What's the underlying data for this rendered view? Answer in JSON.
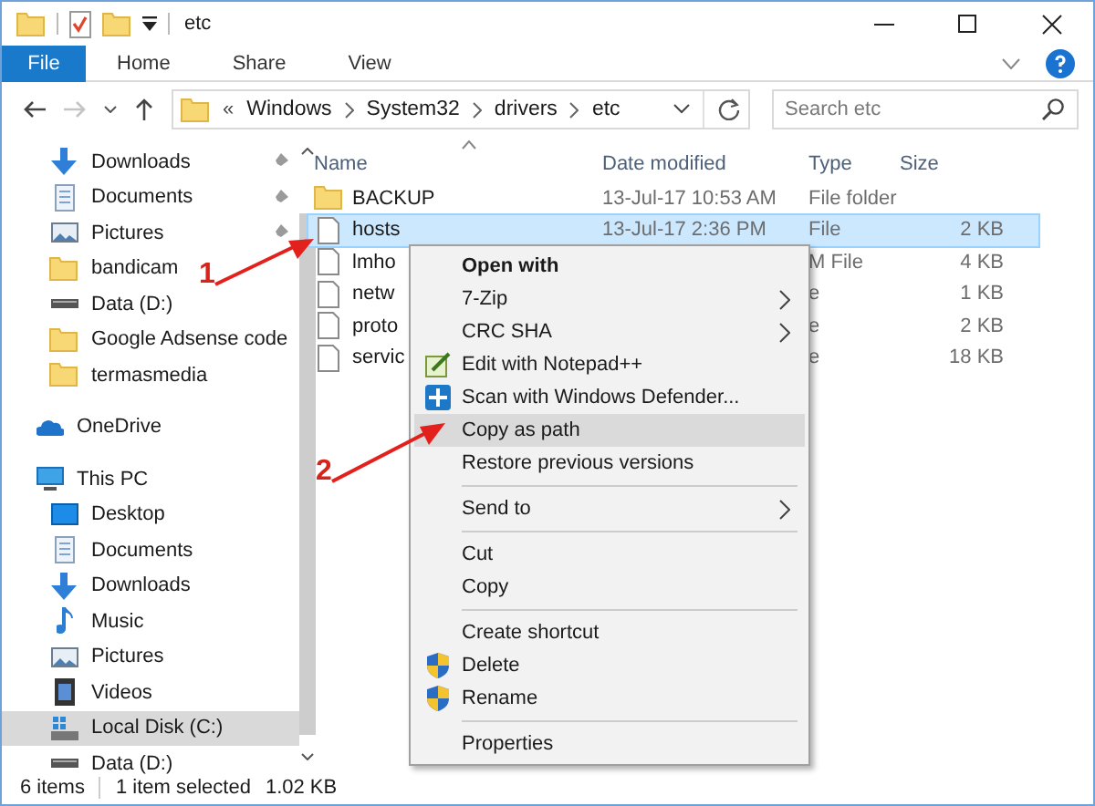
{
  "window": {
    "title": "etc"
  },
  "ribbon": {
    "tabs": [
      {
        "label": "File",
        "selected": true
      },
      {
        "label": "Home",
        "selected": false
      },
      {
        "label": "Share",
        "selected": false
      },
      {
        "label": "View",
        "selected": false
      }
    ]
  },
  "address_bar": {
    "overflow": "«",
    "crumbs": [
      "Windows",
      "System32",
      "drivers",
      "etc"
    ],
    "search": {
      "placeholder": "Search etc"
    },
    "forward_disabled": true
  },
  "sidebar": {
    "quick_access": [
      {
        "label": "Downloads",
        "kind": "download",
        "pinned": true,
        "selected": false
      },
      {
        "label": "Documents",
        "kind": "document",
        "pinned": true,
        "selected": false
      },
      {
        "label": "Pictures",
        "kind": "pictures",
        "pinned": true,
        "selected": false
      },
      {
        "label": "bandicam",
        "kind": "folder",
        "pinned": false,
        "selected": false
      },
      {
        "label": "Data (D:)",
        "kind": "drive",
        "pinned": false,
        "selected": false
      },
      {
        "label": "Google Adsense code",
        "kind": "folder",
        "pinned": false,
        "selected": false
      },
      {
        "label": "termasmedia",
        "kind": "folder",
        "pinned": false,
        "selected": false
      }
    ],
    "locations": [
      {
        "label": "OneDrive",
        "kind": "cloud",
        "selected": false
      },
      {
        "label": "This PC",
        "kind": "pc",
        "selected": false,
        "children": [
          {
            "label": "Desktop",
            "kind": "desktop",
            "selected": false
          },
          {
            "label": "Documents",
            "kind": "document",
            "selected": false
          },
          {
            "label": "Downloads",
            "kind": "download",
            "selected": false
          },
          {
            "label": "Music",
            "kind": "music",
            "selected": false
          },
          {
            "label": "Pictures",
            "kind": "pictures",
            "selected": false
          },
          {
            "label": "Videos",
            "kind": "video",
            "selected": false
          },
          {
            "label": "Local Disk (C:)",
            "kind": "windrive",
            "selected": true
          },
          {
            "label": "Data (D:)",
            "kind": "drive",
            "selected": false
          }
        ]
      }
    ]
  },
  "file_list": {
    "columns": [
      "Name",
      "Date modified",
      "Type",
      "Size"
    ],
    "rows": [
      {
        "name": "BACKUP",
        "kind": "folder",
        "date": "13-Jul-17 10:53 AM",
        "type": "File folder",
        "selected": false
      },
      {
        "name": "hosts",
        "kind": "file",
        "date": "13-Jul-17 2:36 PM",
        "type": "File",
        "size": "2 KB",
        "selected": true
      },
      {
        "name": "lmho",
        "kind": "file",
        "type": "M File",
        "size": "4 KB",
        "selected": false
      },
      {
        "name": "netw",
        "kind": "file",
        "type": "e",
        "size": "1 KB",
        "selected": false
      },
      {
        "name": "proto",
        "kind": "file",
        "type": "e",
        "size": "2 KB",
        "selected": false
      },
      {
        "name": "servic",
        "kind": "file",
        "type": "e",
        "size": "18 KB",
        "selected": false
      }
    ]
  },
  "context_menu": {
    "items": [
      {
        "kind": "plain",
        "label": "Open with",
        "bold": true,
        "submenu": false,
        "selected": false
      },
      {
        "kind": "plain",
        "label": "7-Zip",
        "submenu": true,
        "selected": false
      },
      {
        "kind": "plain",
        "label": "CRC SHA",
        "submenu": true,
        "selected": false
      },
      {
        "kind": "notepad",
        "label": "Edit with Notepad++",
        "submenu": false,
        "selected": false
      },
      {
        "kind": "defender",
        "label": "Scan with Windows Defender...",
        "submenu": false,
        "selected": false
      },
      {
        "kind": "plain",
        "label": "Copy as path",
        "submenu": false,
        "selected": true
      },
      {
        "kind": "plain",
        "label": "Restore previous versions",
        "submenu": false,
        "selected": false
      },
      {
        "kind": "separator"
      },
      {
        "kind": "plain",
        "label": "Send to",
        "submenu": true,
        "selected": false
      },
      {
        "kind": "separator"
      },
      {
        "kind": "plain",
        "label": "Cut",
        "submenu": false,
        "selected": false
      },
      {
        "kind": "plain",
        "label": "Copy",
        "submenu": false,
        "selected": false
      },
      {
        "kind": "separator"
      },
      {
        "kind": "plain",
        "label": "Create shortcut",
        "submenu": false,
        "selected": false
      },
      {
        "kind": "shield",
        "label": "Delete",
        "submenu": false,
        "selected": false
      },
      {
        "kind": "shield",
        "label": "Rename",
        "submenu": false,
        "selected": false
      },
      {
        "kind": "separator"
      },
      {
        "kind": "plain",
        "label": "Properties",
        "submenu": false,
        "selected": false
      }
    ]
  },
  "annotations": [
    {
      "label": "1"
    },
    {
      "label": "2"
    }
  ],
  "status_bar": {
    "count": "6 items",
    "selection": "1 item selected",
    "size": "1.02 KB"
  }
}
